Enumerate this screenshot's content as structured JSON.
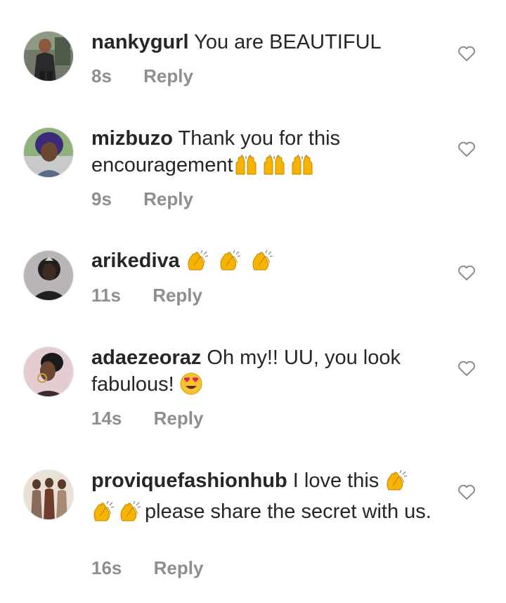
{
  "comments": [
    {
      "username": "nankygurl",
      "text": "You are BEAUTIFUL",
      "time": "8s",
      "reply": "Reply",
      "avatar": "avatar-photo-woman-black-dress",
      "colors": {
        "bg": "#6f7a6b",
        "figure": "#2a2a2a",
        "skin": "#8a5a3c"
      }
    },
    {
      "username": "mizbuzo",
      "text": "Thank you for this encouragement",
      "emojis": [
        "raised-hands",
        "raised-hands",
        "raised-hands"
      ],
      "time": "9s",
      "reply": "Reply",
      "avatar": "avatar-photo-woman-blue-hair",
      "colors": {
        "bg": "#8fb27a",
        "figure": "#3b2a7a",
        "skin": "#6b4632"
      }
    },
    {
      "username": "arikediva",
      "text": "",
      "emojis": [
        "clapping-hands",
        "clapping-hands",
        "clapping-hands"
      ],
      "time": "11s",
      "reply": "Reply",
      "avatar": "avatar-photo-woman-dark",
      "colors": {
        "bg": "#b9b4b8",
        "figure": "#1f1f1f",
        "skin": "#3f2a20"
      }
    },
    {
      "username": "adaezeoraz",
      "text": "Oh my!! UU, you look fabulous!",
      "emojis": [
        "heart-eyes"
      ],
      "time": "14s",
      "reply": "Reply",
      "avatar": "avatar-photo-woman-profile",
      "colors": {
        "bg": "#e4cdd0",
        "figure": "#1a1a1a",
        "skin": "#6b4632"
      }
    },
    {
      "username": "proviquefashionhub",
      "text": "I love this",
      "text2": "please share the secret with us.",
      "emojis": [
        "clapping-hands",
        "clapping-hands",
        "clapping-hands"
      ],
      "time": "16s",
      "reply": "Reply",
      "avatar": "avatar-photo-fashion-group",
      "colors": {
        "bg": "#e8e1d6",
        "figure": "#6e3b2c",
        "skin": "#5a3a2a"
      }
    }
  ],
  "ui": {
    "like_icon": "heart-outline-icon",
    "text_color": "#262626",
    "meta_color": "#8e8e8e",
    "icon_color": "#8e8e8e"
  }
}
